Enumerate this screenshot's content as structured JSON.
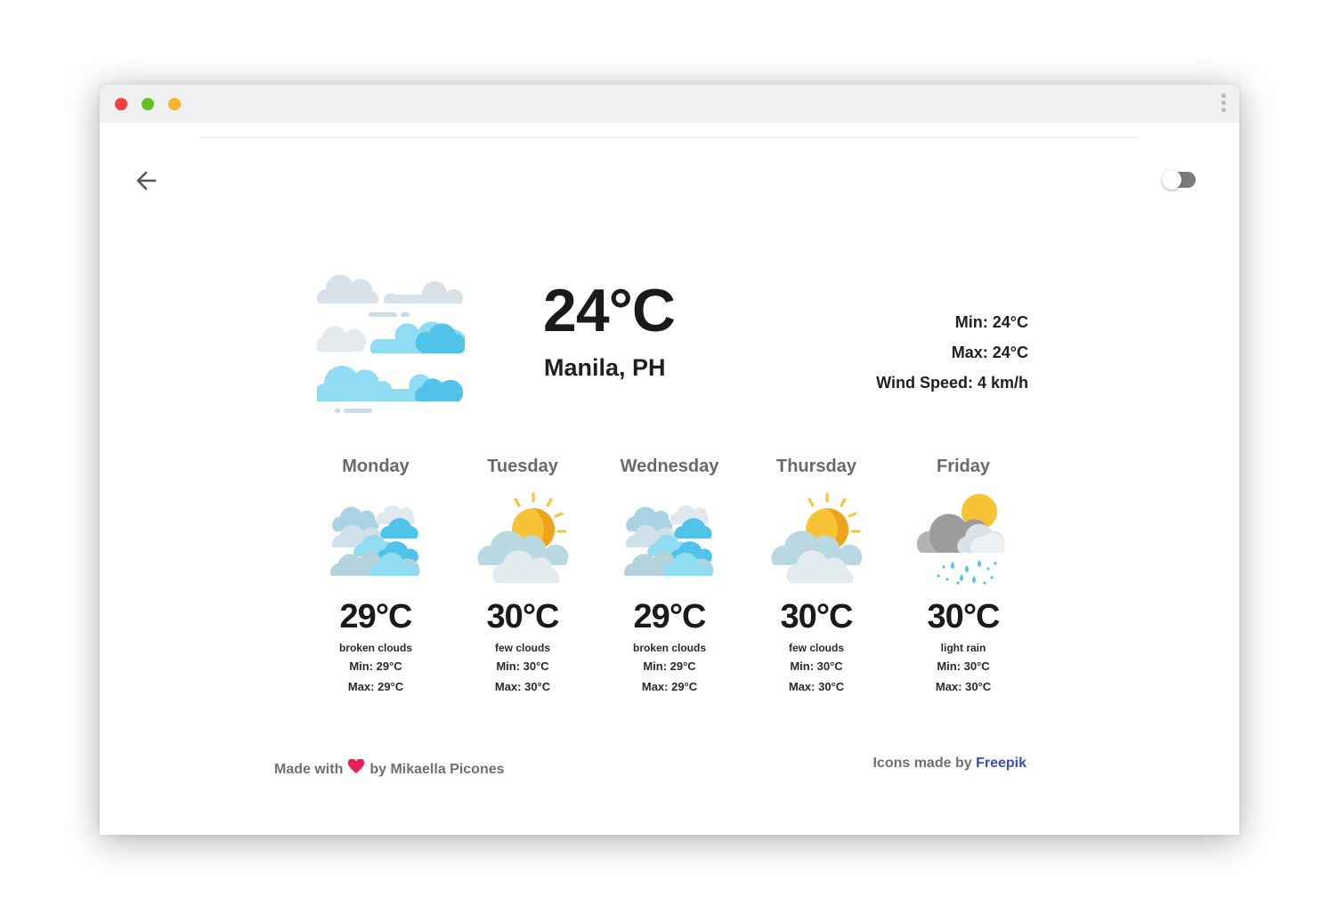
{
  "window": {
    "controls": [
      {
        "name": "close",
        "color": "#f3403c"
      },
      {
        "name": "maximize",
        "color": "#67c021"
      },
      {
        "name": "minimize",
        "color": "#f7b42c"
      }
    ]
  },
  "header": {
    "back_icon": "arrow-left-icon",
    "theme_toggle": {
      "icon": "toggle-switch",
      "state": "off"
    }
  },
  "current": {
    "icon": "clouds-icon",
    "temperature": "24°C",
    "location": "Manila, PH",
    "min": "Min: 24°C",
    "max": "Max: 24°C",
    "wind": "Wind Speed: 4 km/h"
  },
  "forecast": [
    {
      "day": "Monday",
      "icon": "broken-clouds-icon",
      "temp": "29°C",
      "desc": "broken clouds",
      "min": "Min: 29°C",
      "max": "Max: 29°C"
    },
    {
      "day": "Tuesday",
      "icon": "few-clouds-icon",
      "temp": "30°C",
      "desc": "few clouds",
      "min": "Min: 30°C",
      "max": "Max: 30°C"
    },
    {
      "day": "Wednesday",
      "icon": "broken-clouds-icon",
      "temp": "29°C",
      "desc": "broken clouds",
      "min": "Min: 29°C",
      "max": "Max: 29°C"
    },
    {
      "day": "Thursday",
      "icon": "few-clouds-icon",
      "temp": "30°C",
      "desc": "few clouds",
      "min": "Min: 30°C",
      "max": "Max: 30°C"
    },
    {
      "day": "Friday",
      "icon": "light-rain-icon",
      "temp": "30°C",
      "desc": "light rain",
      "min": "Min: 30°C",
      "max": "Max: 30°C"
    }
  ],
  "footer": {
    "made_with": "Made with",
    "heart_icon": "heart-icon",
    "by_author": "by Mikaella Picones",
    "icons_credit": "Icons made by",
    "credit_link": "Freepik"
  },
  "colors": {
    "text_dark": "#1a1a1a",
    "text_muted": "#6a6a6a",
    "link": "#3a4fb5",
    "heart": "#ec1e54",
    "cloud_light": "#d6e3ea",
    "cloud_blue": "#8fdcf3",
    "sun": "#f7c234"
  }
}
